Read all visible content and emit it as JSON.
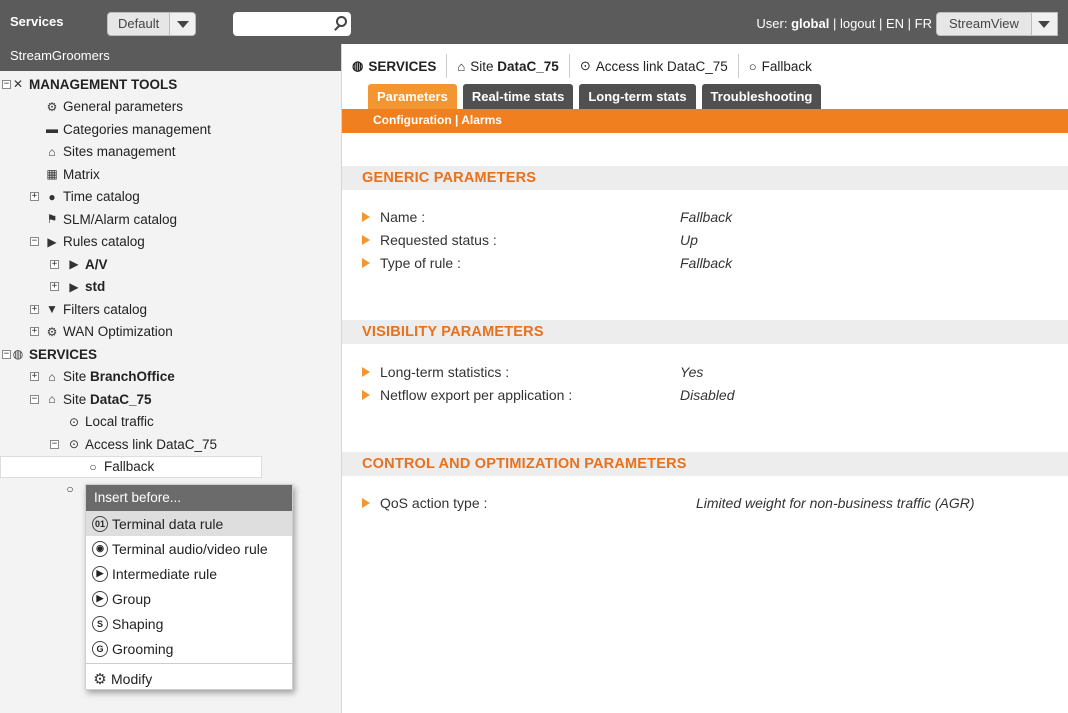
{
  "topbar": {
    "brand": "Services",
    "profile_select": "Default",
    "user_label": "User: ",
    "user_name": "global",
    "sep1": " | ",
    "logout": "logout",
    "sep2": " | ",
    "lang_en": "EN",
    "sep3": " | ",
    "lang_fr": "FR",
    "view_select": "StreamView"
  },
  "sidebar": {
    "header": "StreamGroomers",
    "tree": {
      "management_tools": "MANAGEMENT TOOLS",
      "general_parameters": "General parameters",
      "categories_management": "Categories management",
      "sites_management": "Sites management",
      "matrix": "Matrix",
      "time_catalog": "Time catalog",
      "slm_alarm_catalog": "SLM/Alarm catalog",
      "rules_catalog": "Rules catalog",
      "rule_av": "A/V",
      "rule_std": "std",
      "filters_catalog": "Filters catalog",
      "wan_optimization": "WAN Optimization",
      "services": "SERVICES",
      "site_prefix": "Site ",
      "site_branchoffice": "BranchOffice",
      "site_datac": "DataC_75",
      "local_traffic": "Local traffic",
      "access_link": "Access link DataC_75",
      "fallback": "Fallback"
    }
  },
  "context_menu": {
    "header": "Insert before...",
    "items": [
      {
        "label": "Terminal data rule",
        "icon": "terminal-data-icon"
      },
      {
        "label": "Terminal audio/video rule",
        "icon": "terminal-av-icon"
      },
      {
        "label": "Intermediate rule",
        "icon": "play-circle-icon"
      },
      {
        "label": "Group",
        "icon": "play-circle-icon"
      },
      {
        "label": "Shaping",
        "icon": "shaping-icon"
      },
      {
        "label": "Grooming",
        "icon": "grooming-icon"
      }
    ],
    "modify": "Modify"
  },
  "main": {
    "breadcrumb_tabs": [
      {
        "label": "SERVICES",
        "icon": "globe-icon"
      },
      {
        "label_prefix": "Site ",
        "label_bold": "DataC_75",
        "icon": "house-icon"
      },
      {
        "label": "Access link DataC_75",
        "icon": "play-circle-icon"
      },
      {
        "label": "Fallback",
        "icon": "circle-icon"
      }
    ],
    "tabs": [
      "Parameters",
      "Real-time stats",
      "Long-term stats",
      "Troubleshooting"
    ],
    "subnav": "Configuration | Alarms",
    "sections": {
      "generic": {
        "title": "GENERIC PARAMETERS",
        "rows": [
          {
            "label": "Name :",
            "value": "Fallback"
          },
          {
            "label": "Requested status :",
            "value": "Up"
          },
          {
            "label": "Type of rule :",
            "value": "Fallback"
          }
        ]
      },
      "visibility": {
        "title": "VISIBILITY PARAMETERS",
        "rows": [
          {
            "label": "Long-term statistics :",
            "value": "Yes"
          },
          {
            "label": "Netflow export per application :",
            "value": "Disabled"
          }
        ]
      },
      "control": {
        "title": "CONTROL AND OPTIMIZATION PARAMETERS",
        "rows": [
          {
            "label": "QoS action type :",
            "value": "Limited weight for non-business traffic (AGR)"
          }
        ]
      }
    }
  },
  "colors": {
    "accent": "#f07f20",
    "accent_tab": "#f39530",
    "dark_bar": "#5b5b5b",
    "section_title": "#e8711c"
  }
}
